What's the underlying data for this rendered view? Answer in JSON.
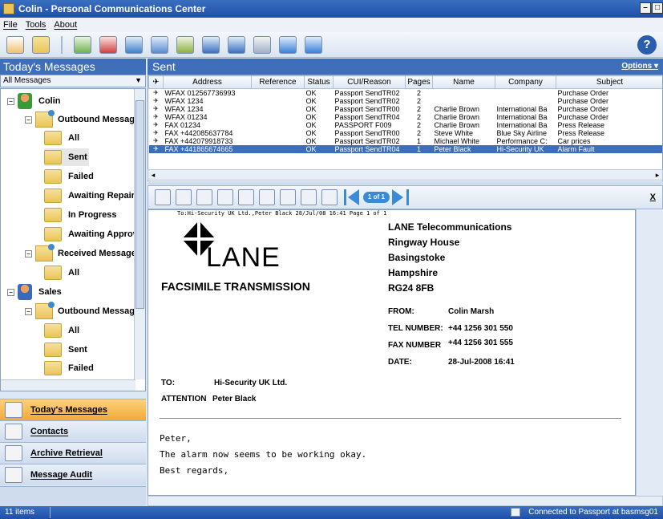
{
  "window": {
    "title": "Colin - Personal Communications Center"
  },
  "menu": [
    "File",
    "Tools",
    "About"
  ],
  "toolbar": {
    "icons": [
      "compose-icon",
      "folder-icon",
      "send-icon",
      "delete-icon",
      "forward-icon",
      "redirect-icon",
      "print-icon",
      "upload-icon",
      "download-icon",
      "search-icon",
      "refresh-icon",
      "sync-icon"
    ],
    "help_label": "?"
  },
  "left": {
    "header": "Today's Messages",
    "filter": "All Messages",
    "tree": {
      "colin": "Colin",
      "outbound": "Outbound Messages",
      "all": "All",
      "sent": "Sent",
      "failed": "Failed",
      "awaiting_repair": "Awaiting Repair",
      "in_progress": "In Progress",
      "awaiting_approval": "Awaiting Approval",
      "received": "Received Messages",
      "received_all": "All",
      "sales": "Sales",
      "sales_outbound": "Outbound Messages",
      "sales_all": "All",
      "sales_sent": "Sent",
      "sales_failed": "Failed"
    },
    "nav": {
      "todays": "Today's Messages",
      "contacts": "Contacts",
      "archive": "Archive Retrieval",
      "audit": "Message Audit"
    }
  },
  "right": {
    "header": "Sent",
    "options_label": "Options",
    "columns": [
      "Address",
      "Reference",
      "Status",
      "CUI/Reason",
      "Pages",
      "Name",
      "Company",
      "Subject"
    ],
    "rows": [
      [
        "WFAX 012567736993",
        "",
        "OK",
        "Passport SendTR02",
        "2",
        "",
        "",
        "Purchase Order"
      ],
      [
        "WFAX 1234",
        "",
        "OK",
        "Passport SendTR02",
        "2",
        "",
        "",
        "Purchase Order"
      ],
      [
        "WFAX 1234",
        "",
        "OK",
        "Passport SendTR00",
        "2",
        "Charlie Brown",
        "International Ba",
        "Purchase Order"
      ],
      [
        "WFAX 01234",
        "",
        "OK",
        "Passport SendTR04",
        "2",
        "Charlie Brown",
        "International Ba",
        "Purchase Order"
      ],
      [
        "FAX 01234",
        "",
        "OK",
        "PASSPORT F009",
        "2",
        "Charlie Brown",
        "International Ba",
        "Press Release"
      ],
      [
        "FAX +442085637784",
        "",
        "OK",
        "Passport SendTR00",
        "2",
        "Steve White",
        "Blue Sky Airline",
        "Press Release"
      ],
      [
        "FAX +442079918733",
        "",
        "OK",
        "Passport SendTR02",
        "1",
        "Michael White",
        "Performance C:",
        "Car prices"
      ],
      [
        "FAX +441865674665",
        "",
        "OK",
        "Passport SendTR04",
        "1",
        "Peter Black",
        "Hi-Security UK",
        "Alarm Fault"
      ]
    ],
    "selected_row": 7,
    "preview_toolbar": {
      "page_indicator": "1 of 1",
      "close_label": "X"
    }
  },
  "fax": {
    "header_line": "To:Hi-Security UK Ltd.,Peter Black 28/Jul/08 16:41 Page 1 of 1",
    "logo_word": "LANE",
    "facsimile": "FACSIMILE TRANSMISSION",
    "company_lines": [
      "LANE Telecommunications",
      "Ringway House",
      "Basingstoke",
      "Hampshire",
      "RG24 8FB"
    ],
    "from_label": "FROM:",
    "from_value": "Colin Marsh",
    "tel_label": "TEL NUMBER:",
    "tel_value": "+44 1256 301 550",
    "fax_label": "FAX NUMBER",
    "fax_value": "+44 1256 301 555",
    "date_label": "DATE:",
    "date_value": "28-Jul-2008 16:41",
    "to_label": "TO:",
    "to_value": "Hi-Security UK Ltd.",
    "attention_label": "ATTENTION",
    "attention_value": "Peter Black",
    "body": [
      "Peter,",
      "The alarm now seems to be working okay.",
      "Best regards,"
    ]
  },
  "status": {
    "items": "11 items",
    "connection": "Connected to Passport at basmsg01"
  }
}
